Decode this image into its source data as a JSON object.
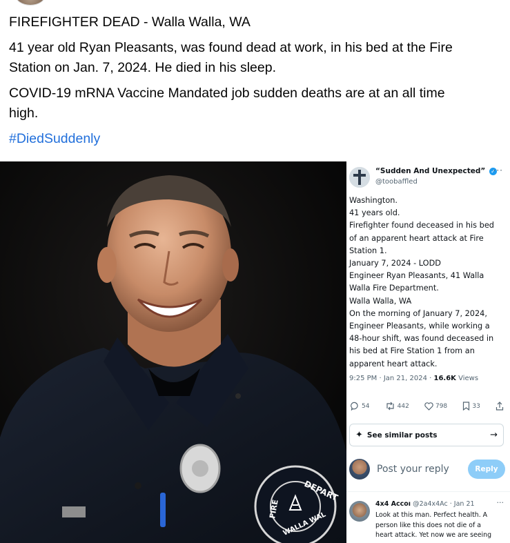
{
  "post": {
    "title": "FIREFIGHTER DEAD - Walla Walla, WA",
    "paragraph1_line1": "41 year old Ryan Pleasants, was found dead at work, in his bed at the Fire",
    "paragraph1_line2": "Station on Jan. 7, 2024. He died in his sleep.",
    "paragraph2_line1": "COVID-19 mRNA Vaccine Mandated job sudden deaths are at an all time",
    "paragraph2_line2": "high.",
    "hashtag": "#DiedSuddenly"
  },
  "photo": {
    "patch_top": "DEPART",
    "patch_bottom": "WALLA WAL",
    "patch_left": "FIRE"
  },
  "tweet": {
    "name": "“Sudden And Unexpected”",
    "handle": "@toobaffled",
    "more": "···",
    "body_lines": [
      "Washington.",
      "41 years old.",
      "Firefighter found deceased in his bed",
      "of an apparent heart attack at Fire",
      "Station 1.",
      "January 7, 2024  -  LODD",
      "Engineer Ryan Pleasants, 41 Walla",
      "Walla Fire Department.",
      "Walla Walla, WA",
      "On the morning of January 7, 2024,",
      "Engineer Pleasants, while working a",
      "48-hour shift, was found deceased in",
      "his bed at Fire Station 1 from an",
      "apparent heart attack."
    ],
    "meta_time": "9:25 PM · Jan 21, 2024 · ",
    "views_count": "16.6K",
    "views_label": " Views",
    "replies": "54",
    "reposts": "442",
    "likes": "798",
    "bookmarks": "33",
    "similar_label": "See similar posts",
    "reply_placeholder": "Post your reply",
    "reply_button": "Reply"
  },
  "reply": {
    "name": "4x4 Accoı",
    "handle": "@2a4x4Ac · Jan 21",
    "more": "···",
    "lines": [
      "Look at this man.  Perfect health.  A",
      "person like this does not die of a",
      "heart attack.  Yet now we are seeing"
    ]
  },
  "colors": {
    "hashtag": "#216fdb",
    "reply_button": "#8ecdf8",
    "verified": "#1d9bf0"
  }
}
